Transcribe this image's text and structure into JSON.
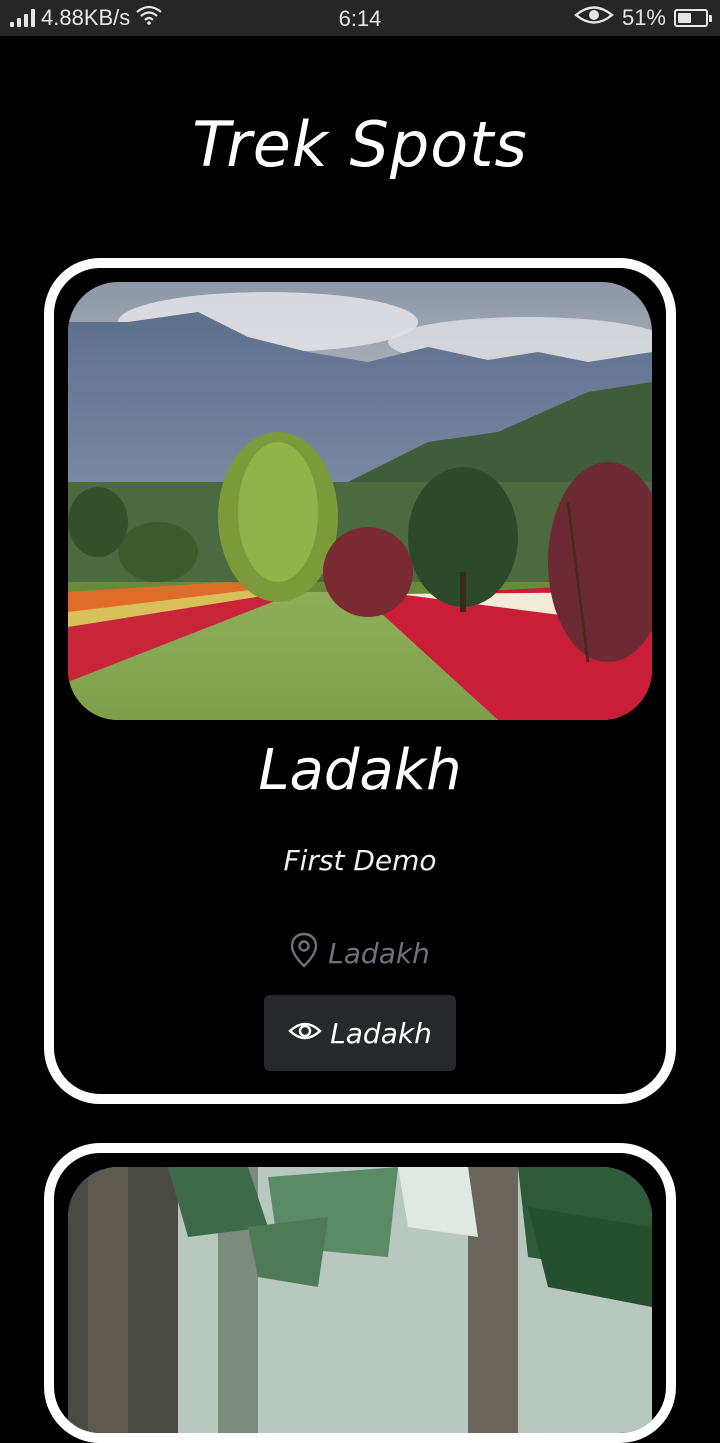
{
  "status_bar": {
    "network_speed": "4.88KB/s",
    "time": "6:14",
    "battery_percent": "51%",
    "battery_level": 0.51,
    "icons": [
      "signal-icon",
      "wifi-icon",
      "eye-comfort-icon",
      "battery-icon"
    ]
  },
  "page": {
    "title": "Trek Spots"
  },
  "spots": [
    {
      "name": "Ladakh",
      "description": "First Demo",
      "location": "Ladakh",
      "button_label": "Ladakh",
      "image": "tulip-garden-mountains-photo"
    },
    {
      "image": "pine-forest-photo"
    }
  ],
  "colors": {
    "background": "#000000",
    "card_border": "#ffffff",
    "button_bg": "#26282c",
    "location_text": "#6f7378",
    "status_bar_bg": "#262626"
  }
}
